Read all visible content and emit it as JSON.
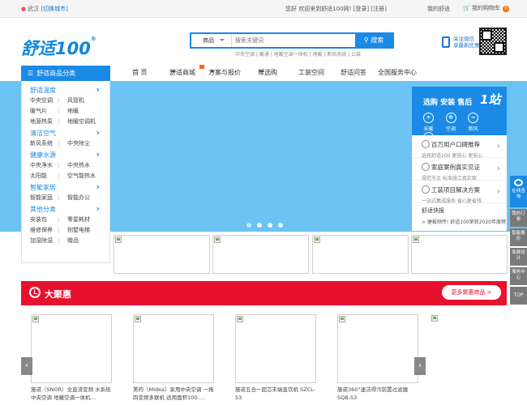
{
  "topbar": {
    "city": "武汉",
    "switch_city": "[切换城市]",
    "welcome": "您好 欢迎来到舒适100网!",
    "login": "[登录]",
    "register": "[注册]",
    "my": "我的舒适",
    "cart": "我的购物车",
    "cart_count": "0"
  },
  "header": {
    "logo": "舒适100",
    "logo_reg": "®",
    "search_category": "商品",
    "search_placeholder": "搜索关键词",
    "search_button": "搜索",
    "hotwords": "中央空调 | 暖通 | 地暖空调一体机 | 地暖 | 新风系统 | 公装",
    "follow_line1": "关注微信",
    "follow_line2": "享最新优惠"
  },
  "nav": {
    "category_button": "舒适商品分类",
    "items": [
      "首 页",
      "舒适商城",
      "方案与报价",
      "帮选购",
      "工装空间",
      "舒适问答",
      "全国服务中心"
    ]
  },
  "sidebar": {
    "groups": [
      {
        "title": "舒适温度",
        "rows": [
          [
            "中央空调",
            "风管机"
          ],
          [
            "暖气片",
            "地暖"
          ],
          [
            "地源热泵",
            "地暖空调机"
          ]
        ]
      },
      {
        "title": "清洁空气",
        "rows": [
          [
            "新风系统",
            "中央除尘"
          ]
        ]
      },
      {
        "title": "健康水源",
        "rows": [
          [
            "中央净水",
            "中央热水"
          ],
          [
            "太阳能",
            "空气能热水"
          ]
        ]
      },
      {
        "title": "智能家居",
        "rows": [
          [
            "智能家庭",
            "智能办公"
          ]
        ]
      },
      {
        "title": "其他分类",
        "rows": [
          [
            "安装包",
            "零星耗材"
          ],
          [
            "维修保养",
            "别墅电梯"
          ],
          [
            "加湿除湿",
            "赠品"
          ]
        ]
      }
    ]
  },
  "right_panel": {
    "title": "选购 安装 售后",
    "badge": "1站",
    "icons": [
      "采暖",
      "空调",
      "新风",
      "净水"
    ],
    "items": [
      {
        "title": "百万用户口碑推荐",
        "sub": "选择舒适100 更放心 更安心"
      },
      {
        "title": "家庭案例真实见证",
        "sub": "规范节点 标准施工真实案"
      },
      {
        "title": "工装项目解决方案",
        "sub": "一站式集成服务 省心更省钱"
      }
    ],
    "news_title": "舒适快报",
    "news_item": "> 捷报频传! 舒适100荣获2020年度榜"
  },
  "side_toolbar": {
    "items": [
      "在线咨询",
      "我的订单",
      "智能报价",
      "免费设计",
      "服务中心",
      "TOP"
    ]
  },
  "sale": {
    "title": "大聚惠",
    "more": "更多聚惠商品 >"
  },
  "products": [
    {
      "name": "施诺（SNOR）全直流变频 水系统中央空调 地暖空调一体机…"
    },
    {
      "name": "美的（Midea）家用中央空调 一拖四变频多联机 适用面积100-…"
    },
    {
      "name": "施诺五合一超芯末端直饮机 SZCL-S3"
    },
    {
      "name": "施诺360°速洁得污前置过滤器 SQB-S3"
    }
  ]
}
